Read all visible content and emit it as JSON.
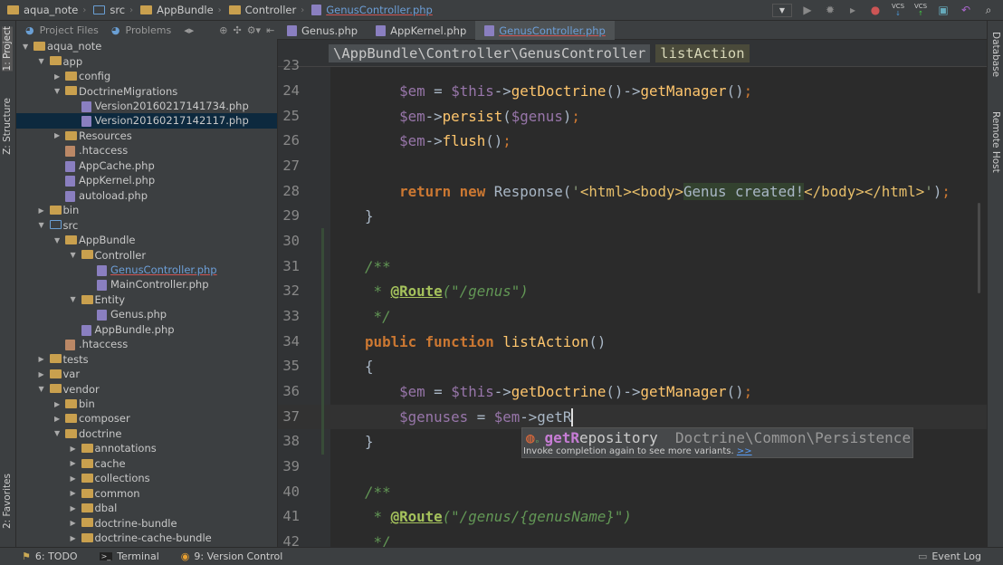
{
  "breadcrumb": [
    "aqua_note",
    "src",
    "AppBundle",
    "Controller",
    "GenusController.php"
  ],
  "toolbar_icons": [
    "dropdown-icon",
    "run-icon",
    "debug-icon",
    "coverage-icon",
    "stop-icon",
    "vcs-update-icon",
    "vcs-commit-icon",
    "history-icon",
    "revert-icon",
    "search-icon"
  ],
  "vcs_label": "VCS",
  "project_bar": {
    "project_files": "Project Files",
    "problems": "Problems"
  },
  "tabs": [
    {
      "label": "Genus.php"
    },
    {
      "label": "AppKernel.php"
    },
    {
      "label": "GenusController.php",
      "active": true
    }
  ],
  "left_strip": {
    "project": "1: Project",
    "structure": "Z: Structure",
    "favorites": "2: Favorites"
  },
  "right_strip": {
    "database": "Database",
    "remote_host": "Remote Host"
  },
  "tree": [
    {
      "label": "aqua_note",
      "level": 0,
      "type": "folder",
      "open": true
    },
    {
      "label": "app",
      "level": 1,
      "type": "folder",
      "open": true
    },
    {
      "label": "config",
      "level": 2,
      "type": "folder",
      "open": false
    },
    {
      "label": "DoctrineMigrations",
      "level": 2,
      "type": "folder",
      "open": true
    },
    {
      "label": "Version20160217141734.php",
      "level": 3,
      "type": "php"
    },
    {
      "label": "Version20160217142117.php",
      "level": 3,
      "type": "php",
      "selected": true
    },
    {
      "label": "Resources",
      "level": 2,
      "type": "folder",
      "open": false
    },
    {
      "label": ".htaccess",
      "level": 2,
      "type": "file"
    },
    {
      "label": "AppCache.php",
      "level": 2,
      "type": "php"
    },
    {
      "label": "AppKernel.php",
      "level": 2,
      "type": "php"
    },
    {
      "label": "autoload.php",
      "level": 2,
      "type": "php"
    },
    {
      "label": "bin",
      "level": 1,
      "type": "folder",
      "open": false
    },
    {
      "label": "src",
      "level": 1,
      "type": "src",
      "open": true
    },
    {
      "label": "AppBundle",
      "level": 2,
      "type": "folder",
      "open": true
    },
    {
      "label": "Controller",
      "level": 3,
      "type": "folder",
      "open": true
    },
    {
      "label": "GenusController.php",
      "level": 4,
      "type": "php",
      "link": true
    },
    {
      "label": "MainController.php",
      "level": 4,
      "type": "php"
    },
    {
      "label": "Entity",
      "level": 3,
      "type": "folder",
      "open": true
    },
    {
      "label": "Genus.php",
      "level": 4,
      "type": "php"
    },
    {
      "label": "AppBundle.php",
      "level": 3,
      "type": "php"
    },
    {
      "label": ".htaccess",
      "level": 2,
      "type": "file"
    },
    {
      "label": "tests",
      "level": 1,
      "type": "folder",
      "open": false
    },
    {
      "label": "var",
      "level": 1,
      "type": "folder",
      "open": false
    },
    {
      "label": "vendor",
      "level": 1,
      "type": "folder",
      "open": true
    },
    {
      "label": "bin",
      "level": 2,
      "type": "folder",
      "open": false
    },
    {
      "label": "composer",
      "level": 2,
      "type": "folder",
      "open": false
    },
    {
      "label": "doctrine",
      "level": 2,
      "type": "folder",
      "open": true
    },
    {
      "label": "annotations",
      "level": 3,
      "type": "folder",
      "open": false
    },
    {
      "label": "cache",
      "level": 3,
      "type": "folder",
      "open": false
    },
    {
      "label": "collections",
      "level": 3,
      "type": "folder",
      "open": false
    },
    {
      "label": "common",
      "level": 3,
      "type": "folder",
      "open": false
    },
    {
      "label": "dbal",
      "level": 3,
      "type": "folder",
      "open": false
    },
    {
      "label": "doctrine-bundle",
      "level": 3,
      "type": "folder",
      "open": false
    },
    {
      "label": "doctrine-cache-bundle",
      "level": 3,
      "type": "folder",
      "open": false
    }
  ],
  "editor_breadcrumb": {
    "class": "\\AppBundle\\Controller\\GenusController",
    "method": "listAction"
  },
  "code": [
    {
      "n": "23",
      "t": []
    },
    {
      "n": "24",
      "t": [
        [
          "        ",
          "pl"
        ],
        [
          "$em",
          "var"
        ],
        [
          " = ",
          "pl"
        ],
        [
          "$this",
          "var"
        ],
        [
          "->",
          "pl"
        ],
        [
          "getDoctrine",
          "fn"
        ],
        [
          "()->",
          "pl"
        ],
        [
          "getManager",
          "fn"
        ],
        [
          "()",
          "pl"
        ],
        [
          ";",
          "punc"
        ]
      ]
    },
    {
      "n": "25",
      "t": [
        [
          "        ",
          "pl"
        ],
        [
          "$em",
          "var"
        ],
        [
          "->",
          "pl"
        ],
        [
          "persist",
          "fn"
        ],
        [
          "(",
          "pl"
        ],
        [
          "$genus",
          "var"
        ],
        [
          ")",
          "pl"
        ],
        [
          ";",
          "punc"
        ]
      ]
    },
    {
      "n": "26",
      "t": [
        [
          "        ",
          "pl"
        ],
        [
          "$em",
          "var"
        ],
        [
          "->",
          "pl"
        ],
        [
          "flush",
          "fn"
        ],
        [
          "()",
          "pl"
        ],
        [
          ";",
          "punc"
        ]
      ]
    },
    {
      "n": "27",
      "t": []
    },
    {
      "n": "28",
      "t": [
        [
          "        ",
          "pl"
        ],
        [
          "return new ",
          "kw"
        ],
        [
          "Response(",
          "pl"
        ],
        [
          "'",
          "str"
        ],
        [
          "<html><body>",
          "tag"
        ],
        [
          "Genus created!",
          "hl"
        ],
        [
          "</body></html>",
          "tag"
        ],
        [
          "'",
          "str"
        ],
        [
          ")",
          "pl"
        ],
        [
          ";",
          "punc"
        ]
      ]
    },
    {
      "n": "29",
      "t": [
        [
          "    }",
          "pl"
        ]
      ]
    },
    {
      "n": "30",
      "t": []
    },
    {
      "n": "31",
      "t": [
        [
          "    /**",
          "cm"
        ]
      ]
    },
    {
      "n": "32",
      "t": [
        [
          "     * ",
          "cm"
        ],
        [
          "@Route",
          "ann"
        ],
        [
          "(\"/genus\")",
          "cm"
        ]
      ]
    },
    {
      "n": "33",
      "t": [
        [
          "     */",
          "cm"
        ]
      ]
    },
    {
      "n": "34",
      "t": [
        [
          "    ",
          "pl"
        ],
        [
          "public function ",
          "kw"
        ],
        [
          "listAction",
          "fn"
        ],
        [
          "()",
          "pl"
        ]
      ]
    },
    {
      "n": "35",
      "t": [
        [
          "    {",
          "pl"
        ]
      ]
    },
    {
      "n": "36",
      "t": [
        [
          "        ",
          "pl"
        ],
        [
          "$em",
          "var"
        ],
        [
          " = ",
          "pl"
        ],
        [
          "$this",
          "var"
        ],
        [
          "->",
          "pl"
        ],
        [
          "getDoctrine",
          "fn"
        ],
        [
          "()->",
          "pl"
        ],
        [
          "getManager",
          "fn"
        ],
        [
          "()",
          "pl"
        ],
        [
          ";",
          "punc"
        ]
      ]
    },
    {
      "n": "37",
      "t": [
        [
          "        ",
          "pl"
        ],
        [
          "$genuses",
          "var"
        ],
        [
          " = ",
          "pl"
        ],
        [
          "$em",
          "var"
        ],
        [
          "->getR",
          "pl"
        ]
      ],
      "current": true
    },
    {
      "n": "38",
      "t": [
        [
          "    }",
          "pl"
        ]
      ]
    },
    {
      "n": "39",
      "t": []
    },
    {
      "n": "40",
      "t": [
        [
          "    /**",
          "cm"
        ]
      ]
    },
    {
      "n": "41",
      "t": [
        [
          "     * ",
          "cm"
        ],
        [
          "@Route",
          "ann"
        ],
        [
          "(\"/genus/{genusName}\")",
          "cm"
        ]
      ]
    },
    {
      "n": "42",
      "t": [
        [
          "     */",
          "cm"
        ]
      ]
    }
  ],
  "completion": {
    "match": "getR",
    "rest": "epository",
    "type": "Doctrine\\Common\\Persistence",
    "hint": "Invoke completion again to see more variants.",
    "more": ">>"
  },
  "status": {
    "todo": "6: TODO",
    "terminal": "Terminal",
    "vcs": "9: Version Control",
    "event_log": "Event Log"
  }
}
